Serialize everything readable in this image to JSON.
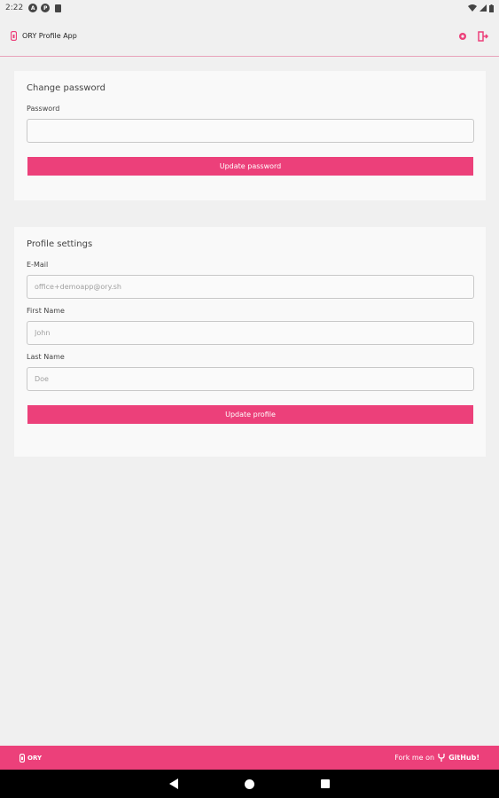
{
  "status_bar": {
    "time": "2:22",
    "icon_a": "A",
    "icon_b": "P"
  },
  "app_bar": {
    "title": "ORY Profile App",
    "logo_icon": "ory-logo-icon",
    "settings_icon": "gear-icon",
    "logout_icon": "logout-icon"
  },
  "change_password": {
    "title": "Change password",
    "password_label": "Password",
    "password_value": "",
    "submit_label": "Update password"
  },
  "profile_settings": {
    "title": "Profile settings",
    "email_label": "E-Mail",
    "email_placeholder": "office+demoapp@ory.sh",
    "first_name_label": "First Name",
    "first_name_placeholder": "John",
    "last_name_label": "Last Name",
    "last_name_placeholder": "Doe",
    "submit_label": "Update profile"
  },
  "footer": {
    "brand": "ORY",
    "fork_text": "Fork me on",
    "github_text": "GitHub!"
  },
  "colors": {
    "accent": "#ec407a",
    "background": "#f0f0f0",
    "card": "#f9f9f9"
  }
}
